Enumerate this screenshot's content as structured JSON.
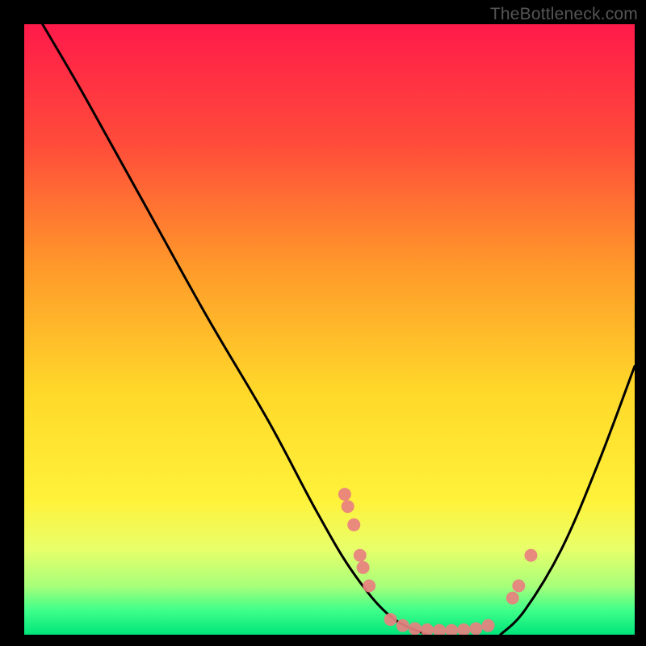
{
  "watermark": "TheBottleneck.com",
  "chart_data": {
    "type": "line",
    "title": "",
    "xlabel": "",
    "ylabel": "",
    "xlim": [
      0,
      100
    ],
    "ylim": [
      0,
      100
    ],
    "gradient_stops": [
      {
        "offset": 0,
        "color": "#ff1a4a"
      },
      {
        "offset": 20,
        "color": "#ff4d3a"
      },
      {
        "offset": 40,
        "color": "#ff9a2a"
      },
      {
        "offset": 60,
        "color": "#ffd82a"
      },
      {
        "offset": 78,
        "color": "#fff23a"
      },
      {
        "offset": 86,
        "color": "#e8ff6a"
      },
      {
        "offset": 92,
        "color": "#a8ff7a"
      },
      {
        "offset": 96,
        "color": "#3fff8a"
      },
      {
        "offset": 100,
        "color": "#00e57a"
      }
    ],
    "curves": [
      {
        "name": "left",
        "points": [
          {
            "x": 3,
            "y": 100
          },
          {
            "x": 10,
            "y": 88
          },
          {
            "x": 20,
            "y": 70
          },
          {
            "x": 30,
            "y": 52
          },
          {
            "x": 40,
            "y": 35
          },
          {
            "x": 48,
            "y": 20
          },
          {
            "x": 54,
            "y": 10
          },
          {
            "x": 60,
            "y": 3
          },
          {
            "x": 66,
            "y": 0
          }
        ]
      },
      {
        "name": "right",
        "points": [
          {
            "x": 78,
            "y": 0
          },
          {
            "x": 82,
            "y": 4
          },
          {
            "x": 88,
            "y": 14
          },
          {
            "x": 94,
            "y": 28
          },
          {
            "x": 100,
            "y": 44
          }
        ]
      }
    ],
    "markers": [
      {
        "x": 52.5,
        "y": 23
      },
      {
        "x": 53.0,
        "y": 21
      },
      {
        "x": 54.0,
        "y": 18
      },
      {
        "x": 55.0,
        "y": 13
      },
      {
        "x": 55.5,
        "y": 11
      },
      {
        "x": 56.5,
        "y": 8
      },
      {
        "x": 60.0,
        "y": 2.5
      },
      {
        "x": 62.0,
        "y": 1.5
      },
      {
        "x": 64.0,
        "y": 1.0
      },
      {
        "x": 66.0,
        "y": 0.8
      },
      {
        "x": 68.0,
        "y": 0.7
      },
      {
        "x": 70.0,
        "y": 0.7
      },
      {
        "x": 72.0,
        "y": 0.8
      },
      {
        "x": 74.0,
        "y": 1.0
      },
      {
        "x": 76.0,
        "y": 1.5
      },
      {
        "x": 80.0,
        "y": 6
      },
      {
        "x": 81.0,
        "y": 8
      },
      {
        "x": 83.0,
        "y": 13
      }
    ],
    "marker_color": "#e88080",
    "marker_radius": 8,
    "curve_color": "#000000",
    "curve_width": 3
  }
}
